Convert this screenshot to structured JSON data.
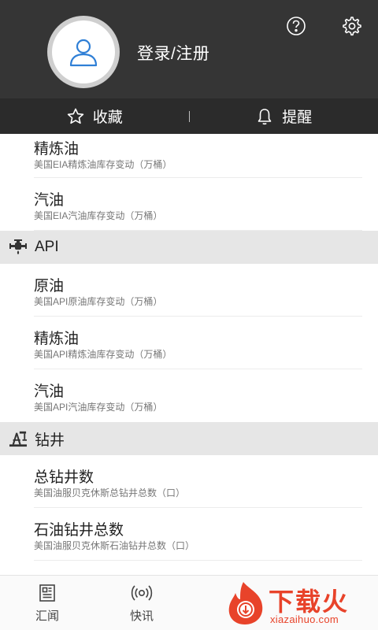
{
  "header": {
    "login_label": "登录/注册",
    "help_icon": "help-circle-icon",
    "settings_icon": "gear-icon",
    "avatar_icon": "user-icon"
  },
  "tabs": [
    {
      "label": "收藏",
      "icon": "star-icon"
    },
    {
      "label": "提醒",
      "icon": "bell-icon"
    }
  ],
  "lists": {
    "eia": [
      {
        "title": "精炼油",
        "sub": "美国EIA精炼油库存变动（万桶）"
      },
      {
        "title": "汽油",
        "sub": "美国EIA汽油库存变动（万桶）"
      }
    ],
    "api_section": {
      "label": "API",
      "icon": "oil-valve-icon"
    },
    "api": [
      {
        "title": "原油",
        "sub": "美国API原油库存变动（万桶）"
      },
      {
        "title": "精炼油",
        "sub": "美国API精炼油库存变动（万桶）"
      },
      {
        "title": "汽油",
        "sub": "美国API汽油库存变动（万桶）"
      }
    ],
    "rig_section": {
      "label": "钻井",
      "icon": "oil-rig-icon"
    },
    "rig": [
      {
        "title": "总钻井数",
        "sub": "美国油服贝克休斯总钻井总数（口）"
      },
      {
        "title": "石油钻井总数",
        "sub": "美国油服贝克休斯石油钻井总数（口）"
      }
    ]
  },
  "bottom_nav": [
    {
      "label": "汇闻",
      "icon": "newspaper-icon"
    },
    {
      "label": "快讯",
      "icon": "broadcast-icon"
    }
  ],
  "watermark": {
    "text": "下载火",
    "url": "xiazaihuo.com",
    "color": "#e8432a"
  },
  "colors": {
    "header_bg": "#353535",
    "tabs_bg": "#2b2b2b",
    "section_bg": "#e6e6e6",
    "avatar_icon": "#2f7fd6"
  }
}
